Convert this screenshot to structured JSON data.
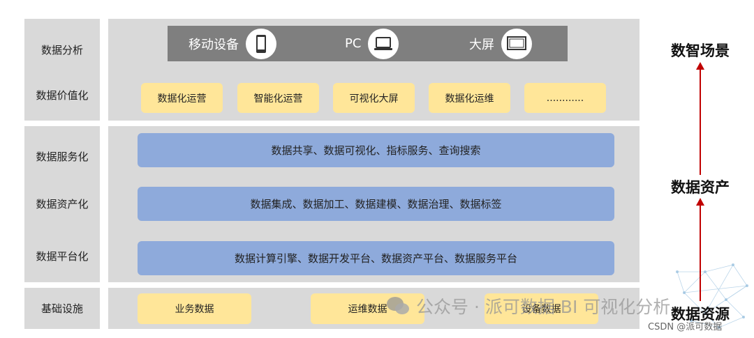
{
  "left_labels": [
    "数据分析",
    "数据价值化",
    "数据服务化",
    "数据资产化",
    "数据平台化",
    "基础设施"
  ],
  "devices": [
    {
      "label": "移动设备",
      "icon": "mobile-phone-icon"
    },
    {
      "label": "PC",
      "icon": "laptop-icon"
    },
    {
      "label": "大屏",
      "icon": "monitor-icon"
    }
  ],
  "value_items": [
    "数据化运营",
    "智能化运营",
    "可视化大屏",
    "数据化运维",
    "............"
  ],
  "service_bars": [
    "数据共享、数据可视化、指标服务、查询搜索",
    "数据集成、数据加工、数据建模、数据治理、数据标签",
    "数据计算引擎、数据开发平台、数据资产平台、数据服务平台"
  ],
  "infra_items": [
    "业务数据",
    "运维数据",
    "设备数据"
  ],
  "stages": [
    "数智场景",
    "数据资产",
    "数据资源"
  ],
  "watermark": "公众号 · 派可数据 BI 可视化分析",
  "credit": "CSDN @派可数据",
  "colors": {
    "panel": "#d9d9d9",
    "device_bar": "#7f7f7f",
    "yellow_box": "#ffe699",
    "blue_bar": "#8eaadb",
    "arrow": "#c00000"
  }
}
